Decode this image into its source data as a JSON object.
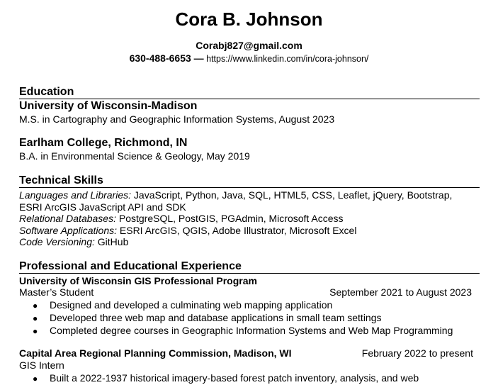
{
  "header": {
    "name": "Cora B. Johnson",
    "email": "Corabj827@gmail.com",
    "phone": "630-488-6653 —",
    "linkedin": " https://www.linkedin.com/in/cora-johnson/"
  },
  "education": {
    "title": "Education",
    "entries": [
      {
        "school": "University of Wisconsin-Madison",
        "detail": "M.S. in Cartography and Geographic Information Systems, August 2023"
      },
      {
        "school": "Earlham College, Richmond, IN",
        "detail": "B.A. in Environmental Science & Geology, May 2019"
      }
    ]
  },
  "skills": {
    "title": "Technical Skills",
    "items": [
      {
        "label": "Languages and Libraries:",
        "value": " JavaScript, Python, Java, SQL, HTML5, CSS, Leaflet, jQuery, Bootstrap,",
        "continuation": "ESRI ArcGIS JavaScript API and SDK"
      },
      {
        "label": "Relational Databases:",
        "value": " PostgreSQL, PostGIS, PGAdmin, Microsoft Access"
      },
      {
        "label": "Software Applications:",
        "value": " ESRI ArcGIS, QGIS, Adobe Illustrator, Microsoft Excel"
      },
      {
        "label": "Code Versioning:",
        "value": " GitHub"
      }
    ]
  },
  "experience": {
    "title": "Professional and Educational Experience",
    "jobs": [
      {
        "org": "University of Wisconsin GIS Professional Program",
        "role": "Master’s Student",
        "dates": "September 2021 to August 2023",
        "bullets": [
          "Designed and developed a culminating web mapping application",
          "Developed three web map and database applications in small team settings",
          "Completed degree courses in Geographic Information Systems and Web Map Programming"
        ]
      },
      {
        "org": "Capital Area Regional Planning Commission, Madison, WI",
        "role": "GIS Intern",
        "dates": "February 2022 to present",
        "bullets": [
          "Built a 2022-1937 historical imagery-based forest patch inventory, analysis, and web"
        ]
      }
    ]
  },
  "bullet_glyph": "●"
}
